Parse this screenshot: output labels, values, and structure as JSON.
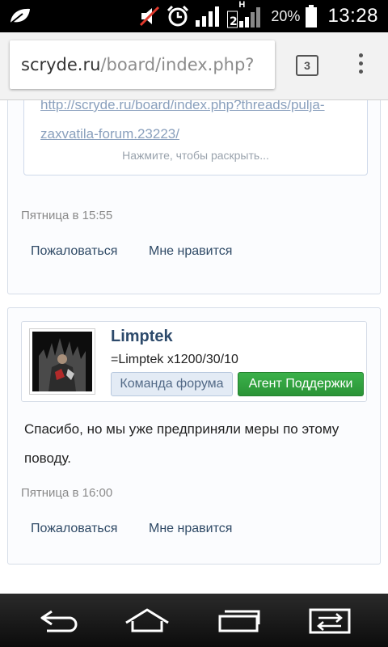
{
  "status_bar": {
    "battery_percent": "20%",
    "time": "13:28",
    "network_label": "H",
    "icons": [
      "app-leaf-icon",
      "mute-icon",
      "alarm-icon",
      "signal-icon",
      "signal-h-icon",
      "battery-icon"
    ]
  },
  "browser": {
    "url_domain": "scryde.ru",
    "url_path": "/board/index.php?",
    "tab_count": "3",
    "menu_icon": "overflow-menu-icon"
  },
  "post_prev": {
    "quote_link_line1": "http://scryde.ru/board/index.php?threads/pulja-",
    "quote_link_line2": "zaxvatila-forum.23223/",
    "quote_expand": "Нажмите, чтобы раскрыть...",
    "date": "Пятница в 15:55",
    "report_label": "Пожаловаться",
    "like_label": "Мне нравится"
  },
  "post_current": {
    "username": "Limptek",
    "user_title": "=Limptek x1200/30/10",
    "badge_team": "Команда форума",
    "badge_agent": "Агент Поддержки",
    "message": "Спасибо, но мы уже предприняли меры по этому поводу.",
    "date": "Пятница в 16:00",
    "report_label": "Пожаловаться",
    "like_label": "Мне нравится"
  },
  "colors": {
    "link": "#8aa0bd",
    "username": "#2d4a6b",
    "agent_badge": "#2e9a3b",
    "team_badge_bg": "#e3ebf5"
  },
  "nav_bar": {
    "icons": [
      "back-icon",
      "home-icon",
      "recent-apps-icon",
      "switch-windows-icon"
    ]
  }
}
